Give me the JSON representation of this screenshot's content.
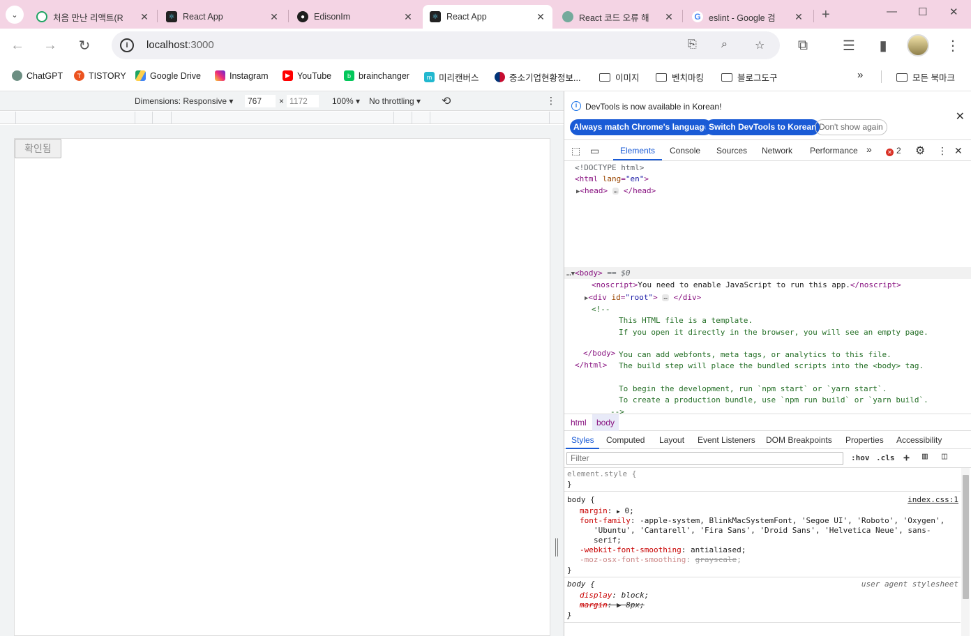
{
  "tabs": [
    {
      "title": "처음 만난 리액트(R",
      "active": false
    },
    {
      "title": "React App",
      "active": false
    },
    {
      "title": "EdisonIm",
      "active": false
    },
    {
      "title": "React App",
      "active": true
    },
    {
      "title": "React 코드 오류 해",
      "active": false
    },
    {
      "title": "eslint - Google 검",
      "active": false
    }
  ],
  "toolbar": {
    "url_host": "localhost",
    "url_port": ":3000"
  },
  "bookmarks": [
    {
      "label": "ChatGPT",
      "color": "#6c8e82"
    },
    {
      "label": "TISTORY",
      "color": "#eb531f"
    },
    {
      "label": "Google Drive",
      "color": "#1fa463"
    },
    {
      "label": "Instagram",
      "color": "#d6249f"
    },
    {
      "label": "YouTube",
      "color": "#ff0000"
    },
    {
      "label": "brainchanger",
      "color": "#03c75a"
    },
    {
      "label": "미리캔버스",
      "color": "#22b8cf"
    },
    {
      "label": "중소기업현황정보...",
      "color": "#c60c30"
    }
  ],
  "bookmark_folders": [
    "이미지",
    "벤치마킹",
    "블로그도구"
  ],
  "all_bookmarks": "모든 북마크",
  "device_toolbar": {
    "dimensions": "Dimensions: Responsive",
    "width": "767",
    "times": "×",
    "height": "1172",
    "zoom": "100%",
    "throttling": "No throttling"
  },
  "page": {
    "button_label": "확인됨"
  },
  "devtools": {
    "infobar_message": "DevTools is now available in Korean!",
    "btn_match": "Always match Chrome's language",
    "btn_switch": "Switch DevTools to Korean",
    "btn_dont_show": "Don't show again",
    "tabs": [
      "Elements",
      "Console",
      "Sources",
      "Network",
      "Performance"
    ],
    "error_count": "2",
    "dom": {
      "doctype": "<!DOCTYPE html>",
      "noscript_text": "You need to enable JavaScript to run this app.",
      "comment_open": "<!--",
      "comment_lines": [
        "This HTML file is a template.",
        "If you open it directly in the browser, you will see an empty page.",
        "",
        "You can add webfonts, meta tags, or analytics to this file.",
        "The build step will place the bundled scripts into the <body> tag.",
        "",
        "To begin the development, run `npm start` or `yarn start`.",
        "To create a production bundle, use `npm run build` or `yarn build`."
      ],
      "comment_close": "-->",
      "body_marker": "== $0"
    },
    "breadcrumbs": [
      "html",
      "body"
    ],
    "style_tabs": [
      "Styles",
      "Computed",
      "Layout",
      "Event Listeners",
      "DOM Breakpoints",
      "Properties",
      "Accessibility"
    ],
    "filter_placeholder": "Filter",
    "hov": ":hov",
    "cls": ".cls",
    "styles": {
      "element_style": "element.style {",
      "body_source": "index.css:1",
      "ua_source": "user agent stylesheet",
      "margin_val": "0;",
      "font_family_val": "-apple-system, BlinkMacSystemFont, 'Segoe UI', 'Roboto', 'Oxygen',",
      "font_family_val2": "'Ubuntu', 'Cantarell', 'Fira Sans', 'Droid Sans', 'Helvetica Neue', sans-",
      "font_family_val3": "serif;",
      "webkit_smoothing": "antialiased;",
      "moz_smoothing": "grayscale",
      "display_val": "block;",
      "ua_margin_val": "8px;"
    }
  }
}
